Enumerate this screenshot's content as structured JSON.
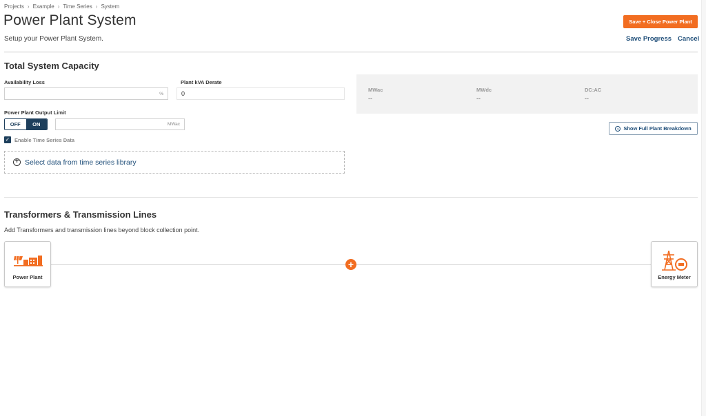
{
  "breadcrumb": [
    "Projects",
    "Example",
    "Time Series",
    "System"
  ],
  "page": {
    "title": "Power Plant System",
    "subtitle": "Setup your Power Plant System."
  },
  "actions": {
    "save_close": "Save + Close Power Plant",
    "save_progress": "Save Progress",
    "cancel": "Cancel"
  },
  "capacity": {
    "title": "Total System Capacity",
    "availability_loss": {
      "label": "Availability Loss",
      "value": "",
      "unit": "%"
    },
    "kva_derate": {
      "label": "Plant kVA Derate",
      "value": "0"
    },
    "output_limit": {
      "label": "Power Plant Output Limit",
      "toggle_off": "OFF",
      "toggle_on": "ON",
      "selected": "ON",
      "value": "",
      "unit": "MWac"
    },
    "time_series": {
      "label": "Enable Time Series Data",
      "checked": true
    },
    "select_data": "Select data from time series library",
    "stats": [
      {
        "label": "MWac",
        "value": "--"
      },
      {
        "label": "MWdc",
        "value": "--"
      },
      {
        "label": "DC:AC",
        "value": "--"
      }
    ],
    "breakdown_button": "Show Full Plant Breakdown"
  },
  "transformers": {
    "title": "Transformers & Transmission Lines",
    "description": "Add Transformers and transmission lines beyond block collection point.",
    "start_node": {
      "label": "Power Plant",
      "icon": "solar-plant-icon"
    },
    "end_node": {
      "label": "Energy Meter",
      "icon": "transmission-tower-meter-icon"
    },
    "add_icon": "add-circle-icon"
  },
  "colors": {
    "accent": "#f26d21",
    "primary": "#1e3f5c",
    "link": "#1f4e79"
  }
}
